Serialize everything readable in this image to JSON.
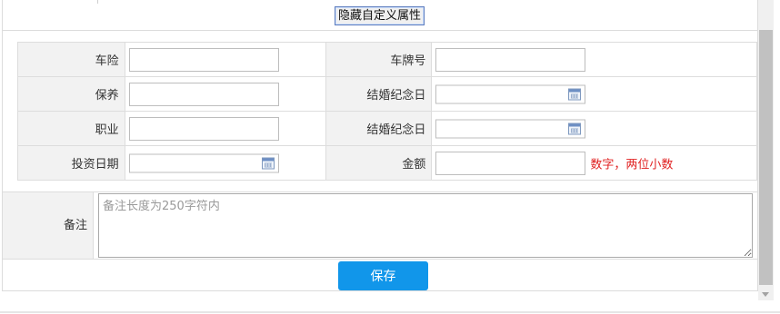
{
  "toolbar": {
    "toggle_label": "隐藏自定义属性"
  },
  "form": {
    "rows": [
      {
        "left": {
          "label": "车险",
          "value": "",
          "type": "text"
        },
        "right": {
          "label": "车牌号",
          "value": "",
          "type": "text"
        }
      },
      {
        "left": {
          "label": "保养",
          "value": "",
          "type": "text"
        },
        "right": {
          "label": "结婚纪念日",
          "value": "",
          "type": "date",
          "icon": "calendar-icon"
        }
      },
      {
        "left": {
          "label": "职业",
          "value": "",
          "type": "text"
        },
        "right": {
          "label": "结婚纪念日",
          "value": "",
          "type": "date",
          "icon": "calendar-icon"
        }
      },
      {
        "left": {
          "label": "投资日期",
          "value": "",
          "type": "date",
          "icon": "calendar-icon"
        },
        "right": {
          "label": "金额",
          "value": "",
          "type": "text",
          "hint": "数字，两位小数"
        }
      }
    ],
    "remark": {
      "label": "备注",
      "placeholder": "备注长度为250字符内",
      "value": ""
    },
    "save_label": "保存"
  },
  "colors": {
    "label_bg": "#f2f2f2",
    "border": "#dddddd",
    "hint": "#e02020",
    "save_button": "#1196ea",
    "scrollbar_thumb": "#c1c1c1"
  }
}
